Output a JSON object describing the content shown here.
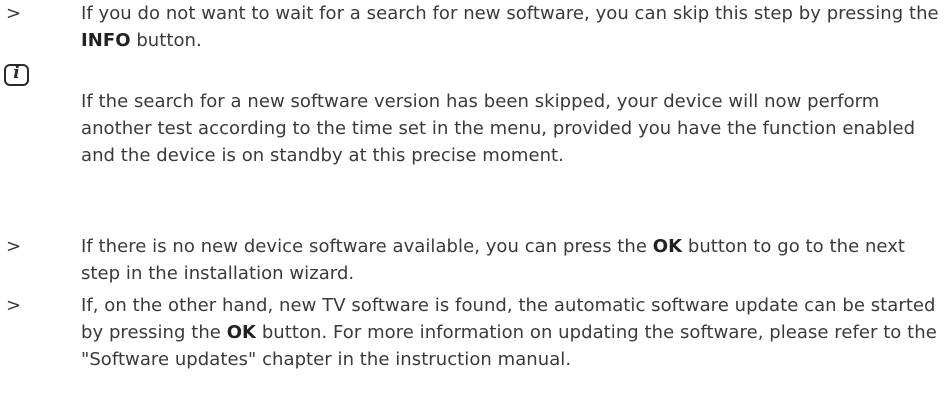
{
  "items": [
    {
      "type": "step",
      "marker": ">",
      "text_before": "If you do not want to wait for a search for new software, you can skip this step by pressing the  ",
      "bold": "INFO",
      "text_after": " button."
    },
    {
      "type": "info",
      "icon": "info-icon",
      "icon_glyph": "i",
      "text": "If the search for a new software version has been skipped, your device will now perform another test according to the time set in the menu, provided you have the function enabled and the device is on standby at this precise moment."
    },
    {
      "type": "step",
      "marker": ">",
      "text_before": "If there is no new device software available, you can press the ",
      "bold": "OK",
      "text_after": " button to go to the next step in the installation wizard."
    },
    {
      "type": "step",
      "marker": ">",
      "text_before": "If, on the other hand, new TV software is found, the automatic software update can be started by pressing the ",
      "bold": "OK",
      "text_after": " button. For more information on updating the software, please refer to the \"Software updates\" chapter in the instruction manual."
    }
  ]
}
